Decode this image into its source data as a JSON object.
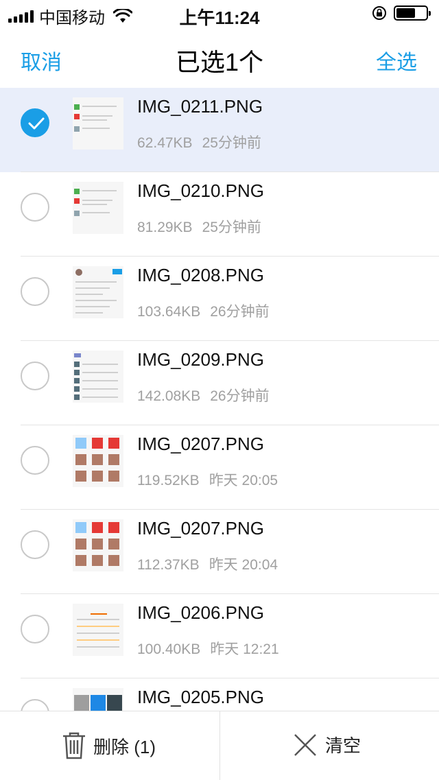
{
  "status": {
    "carrier": "中国移动",
    "time": "上午11:24",
    "battery_level": 0.65
  },
  "nav": {
    "cancel": "取消",
    "title": "已选1个",
    "select_all": "全选"
  },
  "files": [
    {
      "name": "IMG_0211.PNG",
      "size": "62.47KB",
      "time": "25分钟前",
      "selected": true,
      "thumb": "chat-list"
    },
    {
      "name": "IMG_0210.PNG",
      "size": "81.29KB",
      "time": "25分钟前",
      "selected": false,
      "thumb": "chat-list"
    },
    {
      "name": "IMG_0208.PNG",
      "size": "103.64KB",
      "time": "26分钟前",
      "selected": false,
      "thumb": "text"
    },
    {
      "name": "IMG_0209.PNG",
      "size": "142.08KB",
      "time": "26分钟前",
      "selected": false,
      "thumb": "list"
    },
    {
      "name": "IMG_0207.PNG",
      "size": "119.52KB",
      "time": "昨天 20:05",
      "selected": false,
      "thumb": "grid"
    },
    {
      "name": "IMG_0207.PNG",
      "size": "112.37KB",
      "time": "昨天 20:04",
      "selected": false,
      "thumb": "grid"
    },
    {
      "name": "IMG_0206.PNG",
      "size": "100.40KB",
      "time": "昨天 12:21",
      "selected": false,
      "thumb": "calendar"
    },
    {
      "name": "IMG_0205.PNG",
      "size": "",
      "time": "",
      "selected": false,
      "thumb": "photos"
    }
  ],
  "toolbar": {
    "delete_label": "删除 (1)",
    "clear_label": "清空"
  },
  "colors": {
    "accent": "#1a9ee6",
    "selected_row": "#e9eefa",
    "meta_text": "#a0a0a0"
  }
}
